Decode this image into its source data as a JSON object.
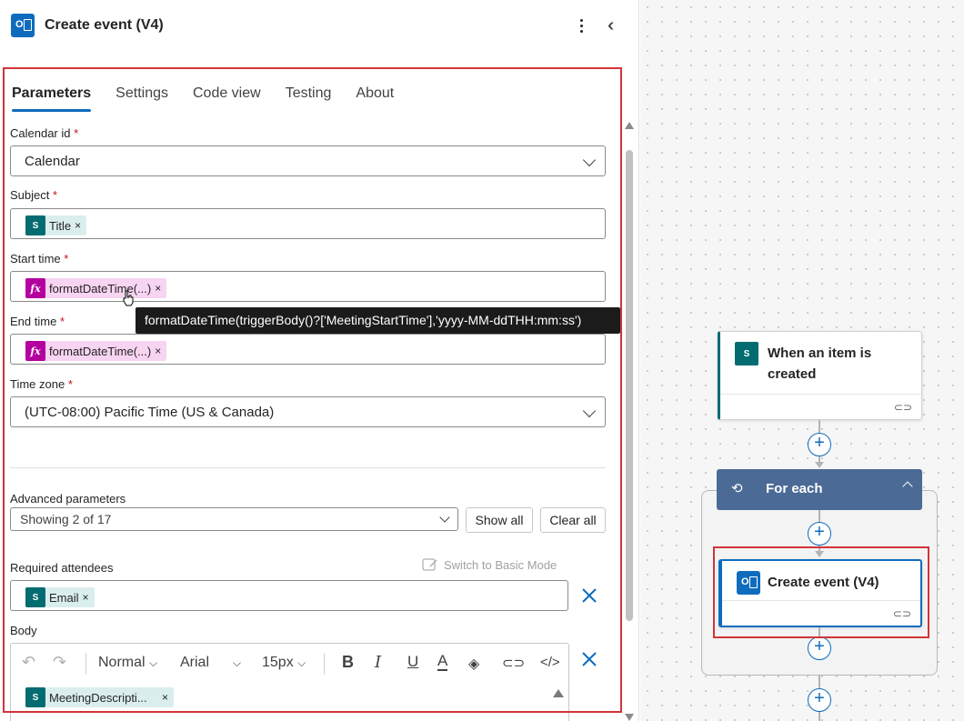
{
  "panel": {
    "title": "Create event (V4)",
    "tabs": [
      "Parameters",
      "Settings",
      "Code view",
      "Testing",
      "About"
    ],
    "active_tab": "Parameters"
  },
  "fields": {
    "calendar_id": {
      "label": "Calendar id",
      "value": "Calendar"
    },
    "subject": {
      "label": "Subject",
      "token": "Title"
    },
    "start_time": {
      "label": "Start time",
      "token": "formatDateTime(...)"
    },
    "end_time": {
      "label": "End time",
      "token": "formatDateTime(...)"
    },
    "time_zone": {
      "label": "Time zone",
      "value": "(UTC-08:00) Pacific Time (US & Canada)"
    },
    "required_marker": "*"
  },
  "tooltip": "formatDateTime(triggerBody()?['MeetingStartTime'],'yyyy-MM-ddTHH:mm:ss')",
  "advanced": {
    "label": "Advanced parameters",
    "value": "Showing 2 of 17",
    "show_all": "Show all",
    "clear_all": "Clear all"
  },
  "attendees": {
    "label": "Required attendees",
    "switch_mode": "Switch to Basic Mode",
    "token": "Email"
  },
  "body": {
    "label": "Body",
    "toolbar": {
      "style": "Normal",
      "font": "Arial",
      "size": "15px"
    },
    "token": "MeetingDescripti..."
  },
  "canvas": {
    "trigger": {
      "title_line1": "When an item is",
      "title_line2": "created"
    },
    "foreach": {
      "title": "For each"
    },
    "action": {
      "title": "Create event (V4)"
    }
  },
  "colors": {
    "accent": "#0f6cbd",
    "highlight_border": "#d13438",
    "sharepoint": "#036c70",
    "expression": "#b4009e",
    "foreach_header": "#4b6a96"
  }
}
